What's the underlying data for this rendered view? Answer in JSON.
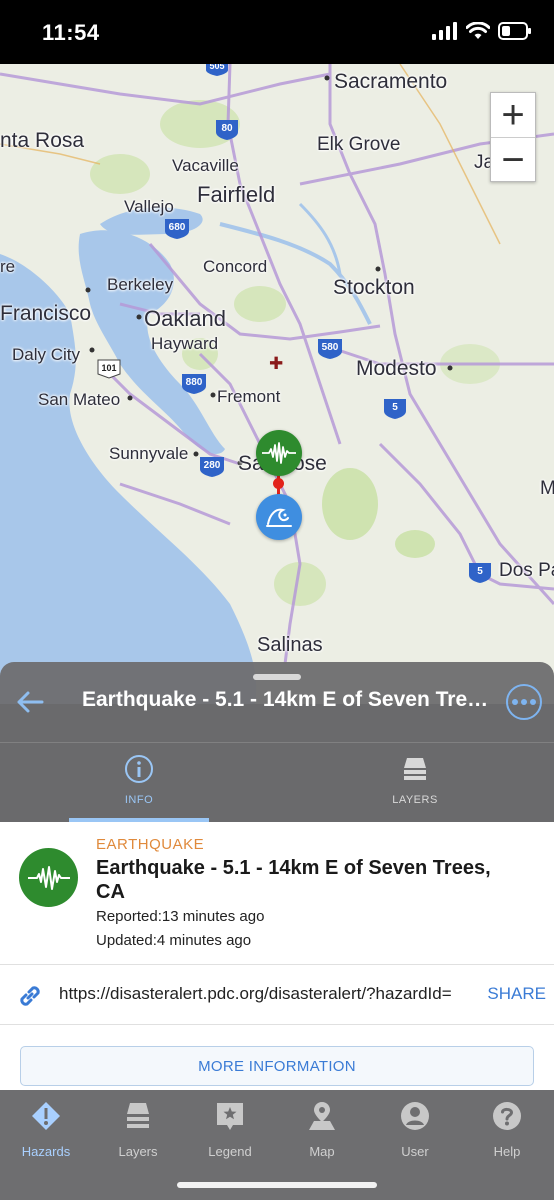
{
  "status_bar": {
    "time": "11:54"
  },
  "map": {
    "labels": {
      "sacramento": "Sacramento",
      "santa_rosa": "nta Rosa",
      "elk_grove": "Elk Grove",
      "vacaville": "Vacaville",
      "fairfield": "Fairfield",
      "vallejo": "Vallejo",
      "concord": "Concord",
      "berkeley": "Berkeley",
      "stockton": "Stockton",
      "francisco": "Francisco",
      "oakland": "Oakland",
      "hayward": "Hayward",
      "daly_city": "Daly City",
      "modesto": "Modesto",
      "san_mateo": "San Mateo",
      "fremont": "Fremont",
      "sunnyvale": "Sunnyvale",
      "san_jose_left": "Sa",
      "san_jose_right": "ose",
      "dos_palos": "Dos Pa",
      "salinas": "Salinas",
      "ja": "Ja",
      "m": "M",
      "re": "re"
    },
    "highway_shields": {
      "i80": "80",
      "i680": "680",
      "i580": "580",
      "us101": "101",
      "i880": "880",
      "i280": "280",
      "i5_north": "5",
      "i5_south": "5",
      "i505": "505"
    },
    "zoom_in": "+",
    "zoom_out": "−"
  },
  "sheet": {
    "title": "Earthquake - 5.1 - 14km E of Seven Trees, CA",
    "tabs": {
      "info": "INFO",
      "layers": "LAYERS"
    }
  },
  "hazard": {
    "type": "EARTHQUAKE",
    "title": "Earthquake - 5.1 - 14km E of Seven Trees, CA",
    "reported": "Reported:13 minutes ago",
    "updated": "Updated:4 minutes ago",
    "url": "https://disasteralert.pdc.org/disasteralert/?hazardId=",
    "share": "SHARE",
    "more_info": "MORE INFORMATION"
  },
  "tabbar": {
    "hazards": "Hazards",
    "layers": "Layers",
    "legend": "Legend",
    "map": "Map",
    "user": "User",
    "help": "Help"
  },
  "colors": {
    "accent": "#3a7bd5",
    "earthquake_green": "#2e8b2e",
    "tsunami_blue": "#3f8ee0",
    "hazard_type_orange": "#e08a3c"
  }
}
